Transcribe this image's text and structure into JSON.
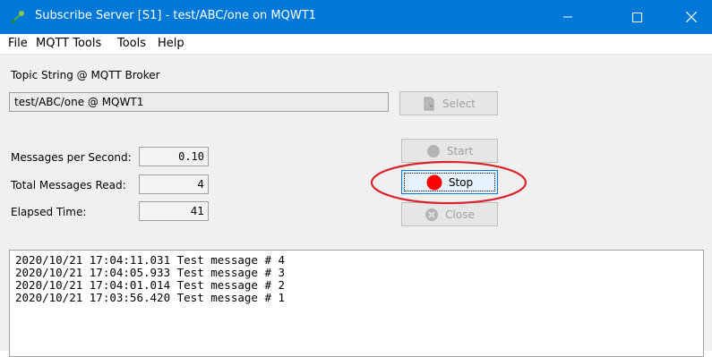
{
  "window": {
    "title": "Subscribe Server [S1] - test/ABC/one on MQWT1"
  },
  "menu": [
    {
      "label": "File"
    },
    {
      "label": "MQTT Tools"
    },
    {
      "label": "Tools"
    },
    {
      "label": "Help"
    }
  ],
  "topic": {
    "label": "Topic String @ MQTT Broker",
    "value": "test/ABC/one @ MQWT1",
    "select_label": "Select"
  },
  "stats": {
    "mps_label": "Messages per Second:",
    "mps_value": "0.10",
    "total_label": "Total Messages Read:",
    "total_value": "4",
    "elapsed_label": "Elapsed Time:",
    "elapsed_value": "41"
  },
  "buttons": {
    "start_label": "Start",
    "stop_label": "Stop",
    "close_label": "Close"
  },
  "log": [
    "2020/10/21 17:04:11.031 Test message # 4",
    "2020/10/21 17:04:05.933 Test message # 3",
    "2020/10/21 17:04:01.014 Test message # 2",
    "2020/10/21 17:03:56.420 Test message # 1"
  ],
  "colors": {
    "titlebar": "#0078d7",
    "stop_dot": "#ff0000",
    "annotation_ring": "#d9232d"
  },
  "icons": {
    "app": "mqtt-app-icon",
    "minimize": "minimize-icon",
    "maximize": "maximize-icon",
    "close": "close-icon",
    "select": "document-icon",
    "start": "start-icon",
    "stop": "stop-icon",
    "close_button": "close-circle-icon"
  }
}
